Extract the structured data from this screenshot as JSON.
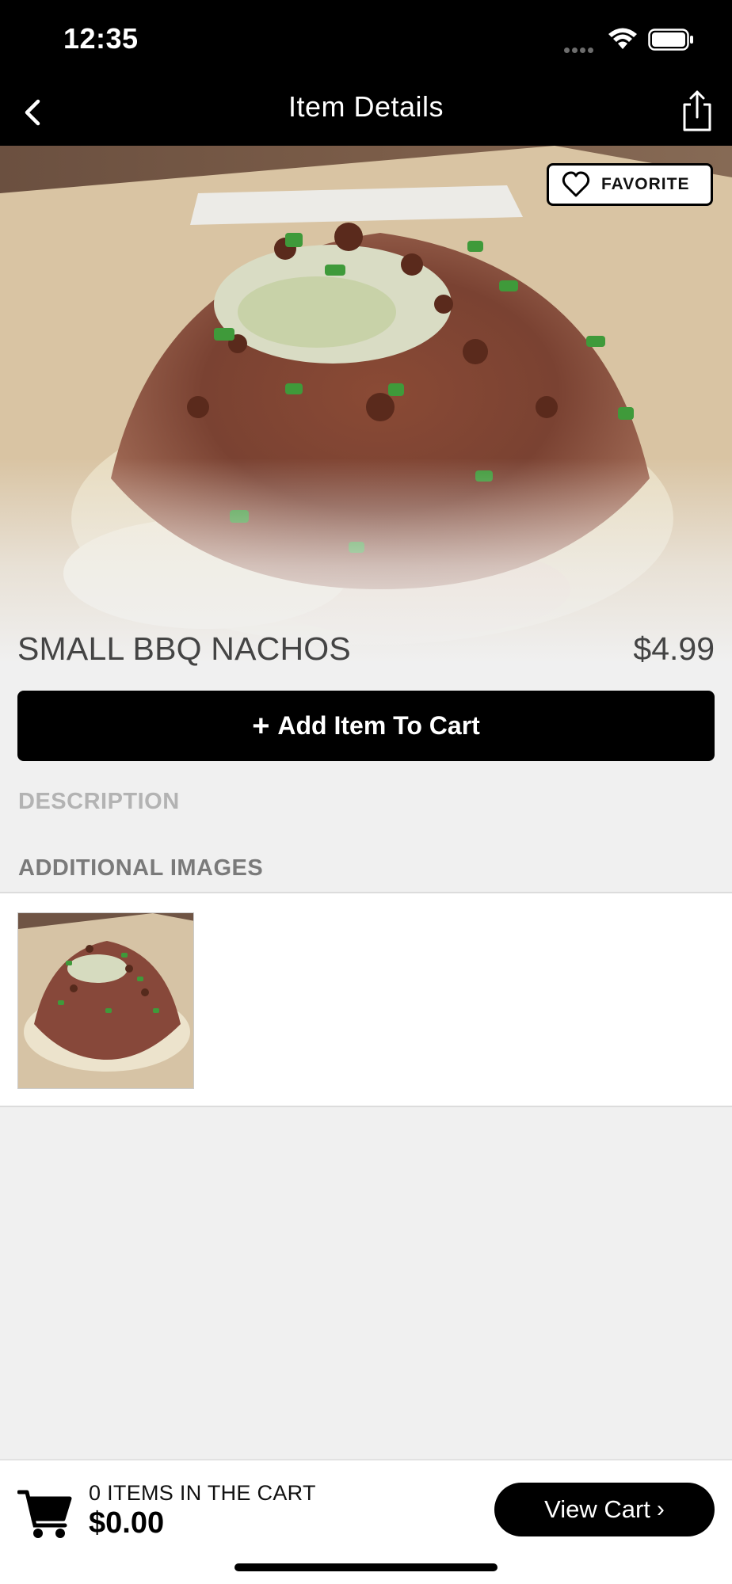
{
  "status_bar": {
    "time": "12:35"
  },
  "nav": {
    "title": "Item Details"
  },
  "favorite": {
    "label": "FAVORITE"
  },
  "item": {
    "name": "SMALL BBQ NACHOS",
    "price": "$4.99"
  },
  "add_to_cart": {
    "label": "Add Item To Cart",
    "icon": "+"
  },
  "sections": {
    "description": "DESCRIPTION",
    "additional_images": "ADDITIONAL IMAGES"
  },
  "cart": {
    "count_text": "0 ITEMS IN THE CART",
    "total": "$0.00",
    "view_label": "View Cart",
    "chevron": "›"
  },
  "icons": [
    "back-icon",
    "share-icon",
    "heart-icon",
    "cart-icon",
    "wifi-icon",
    "battery-icon"
  ],
  "colors": {
    "nav_bg": "#000000",
    "button_bg": "#000000",
    "page_bg": "#f0f0f0"
  }
}
